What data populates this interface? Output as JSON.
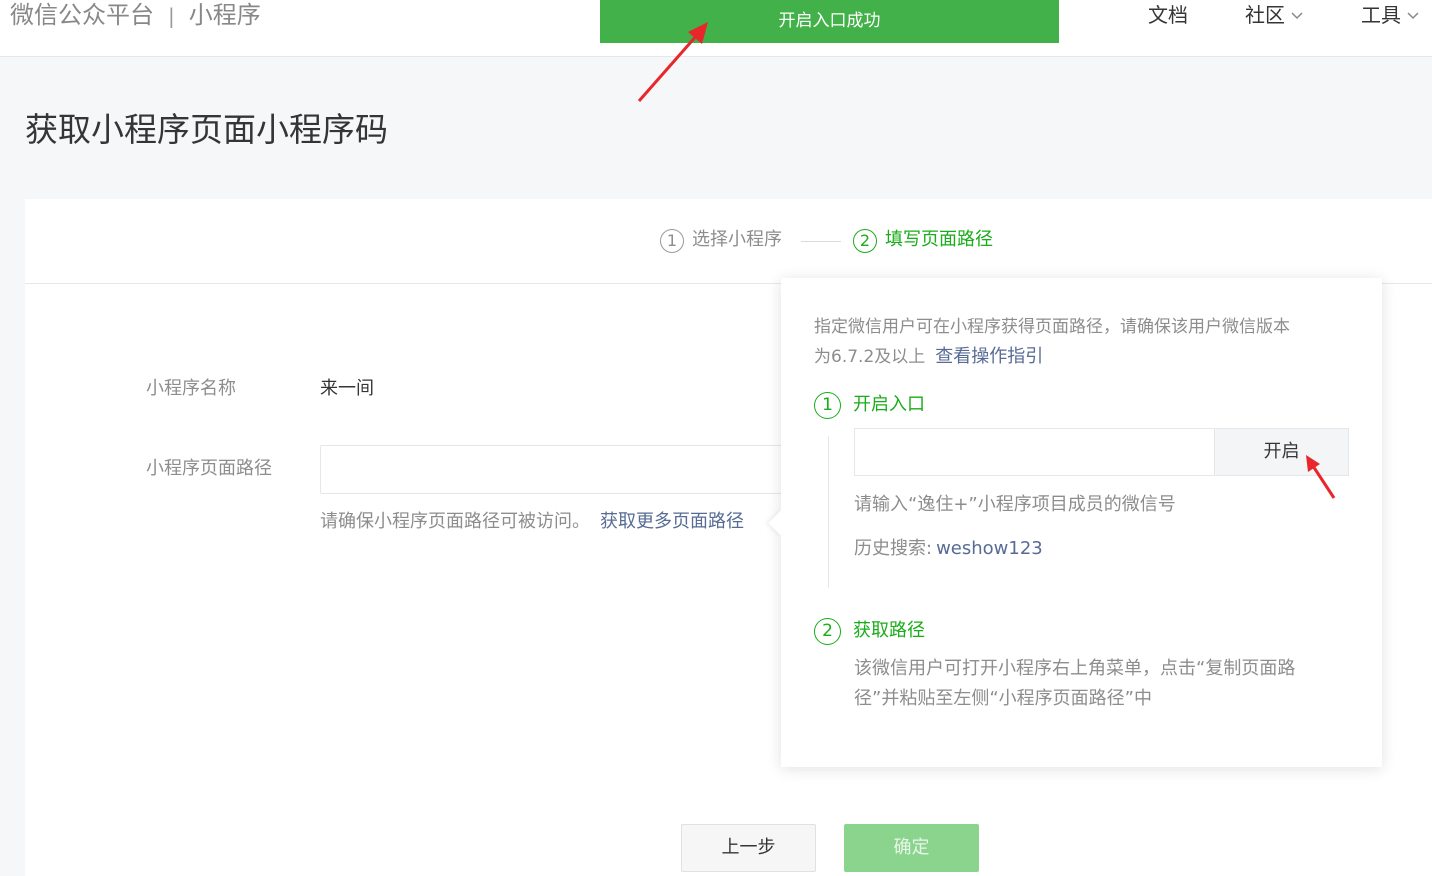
{
  "header": {
    "brand": "微信公众平台",
    "separator": "|",
    "product": "小程序",
    "nav": [
      {
        "label": "文档",
        "has_dropdown": false
      },
      {
        "label": "社区",
        "has_dropdown": true
      },
      {
        "label": "工具",
        "has_dropdown": true
      }
    ],
    "toast": "开启入口成功"
  },
  "page_title": "获取小程序页面小程序码",
  "steps": [
    {
      "number": "1",
      "label": "选择小程序",
      "active": false
    },
    {
      "number": "2",
      "label": "填写页面路径",
      "active": true
    }
  ],
  "form": {
    "name_label": "小程序名称",
    "name_value": "来一间",
    "path_label": "小程序页面路径",
    "path_value": "",
    "hint": "请确保小程序页面路径可被访问。",
    "hint_link": "获取更多页面路径"
  },
  "buttons": {
    "prev": "上一步",
    "ok": "确定"
  },
  "popover": {
    "desc_line1": "指定微信用户可在小程序获得页面路径，请确保该用户微信版本",
    "desc_line2": "为6.7.2及以上",
    "guide_link": "查看操作指引",
    "step1": {
      "number": "1",
      "title": "开启入口",
      "input_value": "",
      "button": "开启",
      "hint": "请输入“逸住+”小程序项目成员的微信号",
      "history_label": "历史搜索:",
      "history_value": "weshow123"
    },
    "step2": {
      "number": "2",
      "title": "获取路径",
      "text_line1": "该微信用户可打开小程序右上角菜单，点击“复制页面路",
      "text_line2": "径”并粘贴至左侧“小程序页面路径”中"
    }
  },
  "colors": {
    "brand_green": "#1aad19",
    "toast_green": "#43b149",
    "link_blue": "#576b95",
    "annotation_red": "#e8262b"
  }
}
